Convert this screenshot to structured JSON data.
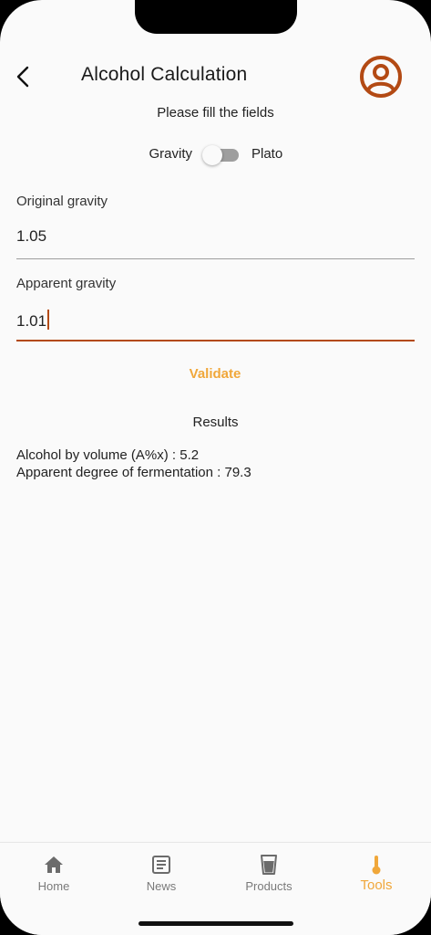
{
  "header": {
    "title": "Alcohol Calculation",
    "back_icon": "chevron-left-icon",
    "profile_icon": "account-circle-icon"
  },
  "form": {
    "instruction": "Please fill the fields",
    "toggle": {
      "left_label": "Gravity",
      "right_label": "Plato",
      "on": false
    },
    "original_gravity": {
      "label": "Original gravity",
      "value": "1.05"
    },
    "apparent_gravity": {
      "label": "Apparent gravity",
      "value": "1.01"
    },
    "validate_label": "Validate"
  },
  "results": {
    "title": "Results",
    "abv_line": "Alcohol by volume (A%x) : 5.2",
    "fermentation_line": "Apparent degree of fermentation : 79.3"
  },
  "nav": {
    "items": [
      {
        "label": "Home",
        "icon": "home-icon"
      },
      {
        "label": "News",
        "icon": "news-icon"
      },
      {
        "label": "Products",
        "icon": "glass-icon"
      },
      {
        "label": "Tools",
        "icon": "thermometer-icon"
      }
    ],
    "active": "Tools"
  },
  "colors": {
    "accent": "#f0a73a",
    "brand": "#b34a14",
    "background": "#fafafa"
  }
}
